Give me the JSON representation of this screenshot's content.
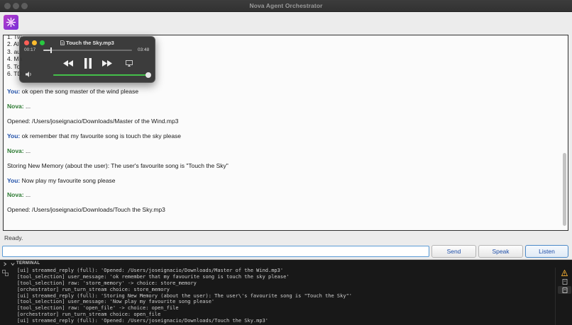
{
  "window": {
    "title": "Nova Agent Orchestrator"
  },
  "chat": {
    "list_lines": [
      "1. Tw",
      "2. Al",
      "3. au",
      "4. Ma",
      "5. To",
      "6. TD"
    ],
    "messages": [
      {
        "speaker": "You:",
        "text": " ok open the song master of the wind please"
      },
      {
        "speaker": "Nova:",
        "text": " ..."
      },
      {
        "speaker": "",
        "text": "Opened: /Users/joseignacio/Downloads/Master of the Wind.mp3"
      },
      {
        "speaker": "You:",
        "text": " ok remember that my favourite song is touch the sky please"
      },
      {
        "speaker": "Nova:",
        "text": " ..."
      },
      {
        "speaker": "",
        "text": "Storing New Memory (about the user): The user's favourite song is \"Touch the Sky\""
      },
      {
        "speaker": "You:",
        "text": " Now play my favourite song please"
      },
      {
        "speaker": "Nova:",
        "text": " ..."
      },
      {
        "speaker": "",
        "text": "Opened: /Users/joseignacio/Downloads/Touch the Sky.mp3"
      }
    ]
  },
  "status": {
    "text": "Ready."
  },
  "input": {
    "value": ""
  },
  "buttons": {
    "send": "Send",
    "speak": "Speak",
    "listen": "Listen"
  },
  "player": {
    "title": "Touch the Sky.mp3",
    "elapsed": "00:17",
    "remaining": "03:48",
    "progress_fraction": 0.08,
    "volume_fraction": 1.0
  },
  "terminal": {
    "header": "TERMINAL",
    "lines": [
      "[ui] streamed_reply (full): 'Opened: /Users/joseignacio/Downloads/Master of the Wind.mp3'",
      "[tool_selection] user_message: 'ok remember that my favourite song is touch the sky please'",
      "[tool_selection] raw: 'store_memory' -> choice: store_memory",
      "[orchestrator] run_turn_stream choice: store_memory",
      "[ui] streamed_reply (full): 'Storing New Memory (about the user): The user\\'s favourite song is \"Touch the Sky\"'",
      "[tool_selection] user_message: 'Now play my favourite song please'",
      "[tool_selection] raw: 'open_file' -> choice: open_file",
      "[orchestrator] run_turn_stream choice: open_file",
      "[ui] streamed_reply (full): 'Opened: /Users/joseignacio/Downloads/Touch the Sky.mp3'"
    ]
  },
  "colors": {
    "you": "#1f4fa8",
    "nova": "#2c7a32",
    "accent": "#4a88c7",
    "volume": "#44c04a"
  }
}
